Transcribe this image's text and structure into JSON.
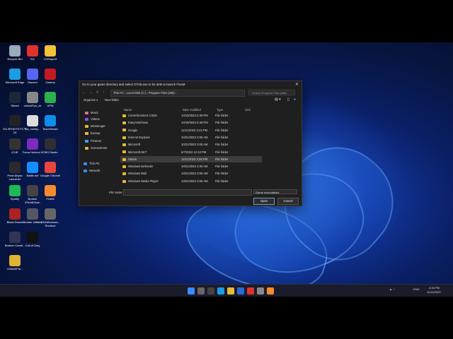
{
  "desktop": {
    "icons": [
      {
        "label": "Recycle Bin",
        "color": "#9ab"
      },
      {
        "label": "EA",
        "color": "#e0322b"
      },
      {
        "label": "LDPlayer9",
        "color": "#f6c23a"
      },
      {
        "label": "Microsoft Edge",
        "color": "#1b9de2"
      },
      {
        "label": "Discord",
        "color": "#5865f2"
      },
      {
        "label": "Garena",
        "color": "#c01b22"
      },
      {
        "label": "Steam",
        "color": "#1b2838"
      },
      {
        "label": "unlockFps_clr",
        "color": "#888"
      },
      {
        "label": "UPM",
        "color": "#2fae4e"
      },
      {
        "label": "EA SPORTS FC™ 24",
        "color": "#222"
      },
      {
        "label": "fps_config...",
        "color": "#ddd"
      },
      {
        "label": "TeamViewer",
        "color": "#0e8ee9"
      },
      {
        "label": "iCUE",
        "color": "#333"
      },
      {
        "label": "Forza Horizon 5",
        "color": "#7c2ac0"
      },
      {
        "label": "OBS Studio",
        "color": "#302e31"
      },
      {
        "label": "Pearl Abyss Launcher",
        "color": "#2b2b2b"
      },
      {
        "label": "Battle.net",
        "color": "#148eff"
      },
      {
        "label": "Google Chrome",
        "color": "#e8453c"
      },
      {
        "label": "Spotify",
        "color": "#1db954"
      },
      {
        "label": "Brother iPrint&Scan",
        "color": "#444"
      },
      {
        "label": "FiveM",
        "color": "#f68a2f"
      },
      {
        "label": "Black Desert",
        "color": "#a22"
      },
      {
        "label": "Brother Utilities",
        "color": "#556"
      },
      {
        "label": "DS4Windows - Shortcut",
        "color": "#666"
      },
      {
        "label": "Brother Creati...",
        "color": "#335"
      },
      {
        "label": "Call of Duty",
        "color": "#111"
      },
      {
        "label": "LDMultiPla...",
        "color": "#e0b330"
      }
    ]
  },
  "dialog": {
    "title": "Go to your game directory and select GTA5.exe to be able to launch FiveM",
    "close": "✕",
    "breadcrumb": [
      "This PC",
      "Local Disk (C:)",
      "Program Files (x86)"
    ],
    "search_placeholder": "Search Program Files (x86)",
    "organize": "Organize ▾",
    "new_folder": "New folder",
    "nav": [
      {
        "label": "Music"
      },
      {
        "label": "Videos"
      },
      {
        "label": "Messenger"
      },
      {
        "label": "backup"
      },
      {
        "label": "Pictures"
      },
      {
        "label": "Screenshots"
      },
      {
        "label": "This PC"
      },
      {
        "label": "Network"
      }
    ],
    "columns": {
      "name": "Name",
      "date": "Date modified",
      "type": "Type",
      "size": "Size"
    },
    "files": [
      {
        "name": "ControlCenter4 CSDK",
        "date": "10/10/2023 5:38 PM",
        "type": "File folder"
      },
      {
        "name": "EasyAntiCheat",
        "date": "10/19/2023 6:49 PM",
        "type": "File folder"
      },
      {
        "name": "Google",
        "date": "11/11/2023 3:43 PM",
        "type": "File folder"
      },
      {
        "name": "Internet Explorer",
        "date": "10/21/2023 3:05 AM",
        "type": "File folder"
      },
      {
        "name": "Microsoft",
        "date": "10/21/2023 3:05 AM",
        "type": "File folder"
      },
      {
        "name": "Microsoft.NET",
        "date": "5/7/2022 12:42 PM",
        "type": "File folder"
      },
      {
        "name": "Steam",
        "date": "11/11/2023 4:28 PM",
        "type": "File folder"
      },
      {
        "name": "Windows Defender",
        "date": "10/21/2023 4:30 AM",
        "type": "File folder"
      },
      {
        "name": "Windows Mail",
        "date": "10/21/2023 3:05 AM",
        "type": "File folder"
      },
      {
        "name": "Windows Media Player",
        "date": "10/21/2023 3:05 AM",
        "type": "File folder"
      }
    ],
    "filename_label": "File name:",
    "filter": "Game executables",
    "open": "Open",
    "cancel": "Cancel"
  },
  "taskbar": {
    "lang": "ENG",
    "time": "4:34 PM",
    "date": "11/11/2023"
  }
}
